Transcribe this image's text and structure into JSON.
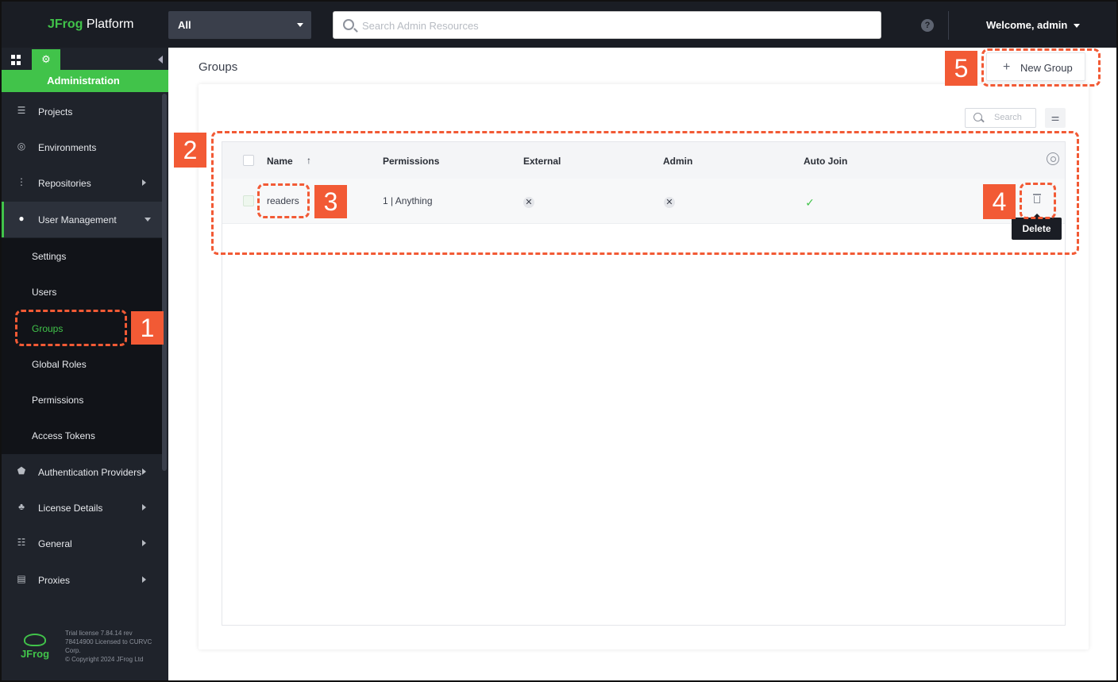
{
  "topbar": {
    "logo_brand": "JFrog",
    "logo_product": " Platform",
    "scope_value": "All",
    "search_placeholder": "Search Admin Resources",
    "help_glyph": "?",
    "welcome": "Welcome, admin"
  },
  "sidebar": {
    "admin_label": "Administration",
    "items": [
      {
        "label": "Projects",
        "icon": "projects-icon"
      },
      {
        "label": "Environments",
        "icon": "environments-icon"
      },
      {
        "label": "Repositories",
        "icon": "repositories-icon"
      },
      {
        "label": "User Management",
        "icon": "user-icon"
      },
      {
        "label": "Authentication Providers",
        "icon": "shield-icon"
      },
      {
        "label": "License Details",
        "icon": "license-icon"
      },
      {
        "label": "General",
        "icon": "sliders-icon"
      },
      {
        "label": "Proxies",
        "icon": "server-icon"
      }
    ],
    "sub_items": [
      {
        "label": "Settings"
      },
      {
        "label": "Users"
      },
      {
        "label": "Groups"
      },
      {
        "label": "Global Roles"
      },
      {
        "label": "Permissions"
      },
      {
        "label": "Access Tokens"
      }
    ],
    "footer_logo_text": "JFrog",
    "footer_text_1": "Trial license 7.84.14 rev 78414900 Licensed to CURVC Corp.",
    "footer_text_2": "© Copyright 2024 JFrog Ltd"
  },
  "main": {
    "page_title": "Groups",
    "new_group_label": "New Group",
    "table_search_placeholder": "Search",
    "columns": [
      "Name",
      "Permissions",
      "External",
      "Admin",
      "Auto Join"
    ],
    "rows": [
      {
        "name": "readers",
        "permissions": "1 | Anything",
        "external": false,
        "admin": false,
        "auto_join": true
      }
    ],
    "delete_tooltip": "Delete"
  },
  "annotations": [
    "1",
    "2",
    "3",
    "4",
    "5"
  ],
  "colors": {
    "accent": "#41c34a",
    "annotation": "#f25a35",
    "topbar": "#1a1d24",
    "sidebar": "#1f232b"
  }
}
